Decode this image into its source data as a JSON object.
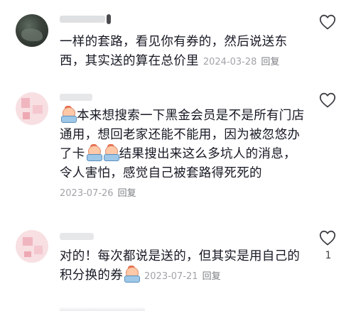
{
  "comments": [
    {
      "username": "",
      "text": "一样的套路，看见你有券的，然后说送东西，其实送的算在总价里",
      "date": "2024-03-28",
      "reply_label": "回复",
      "like_count": ""
    },
    {
      "username": "",
      "text_part1": "本来想搜索一下黑金会员是不是所有门店通用，想回老家还能不能用，因为被忽悠办了卡",
      "text_part2": "结果搜出来这么多坑人的消息，令人害怕，感觉自己被套路得死死的",
      "date": "2023-07-26",
      "reply_label": "回复",
      "like_count": ""
    },
    {
      "username": "",
      "text": "对的！每次都说是送的，但其实是用自己的积分换的券",
      "date": "2023-07-21",
      "reply_label": "回复",
      "like_count": "1"
    }
  ],
  "icons": {
    "like": "heart-outline-icon",
    "emoji": "sticker-emoji-icon",
    "heart_stroke_color": "#3d3f45"
  }
}
